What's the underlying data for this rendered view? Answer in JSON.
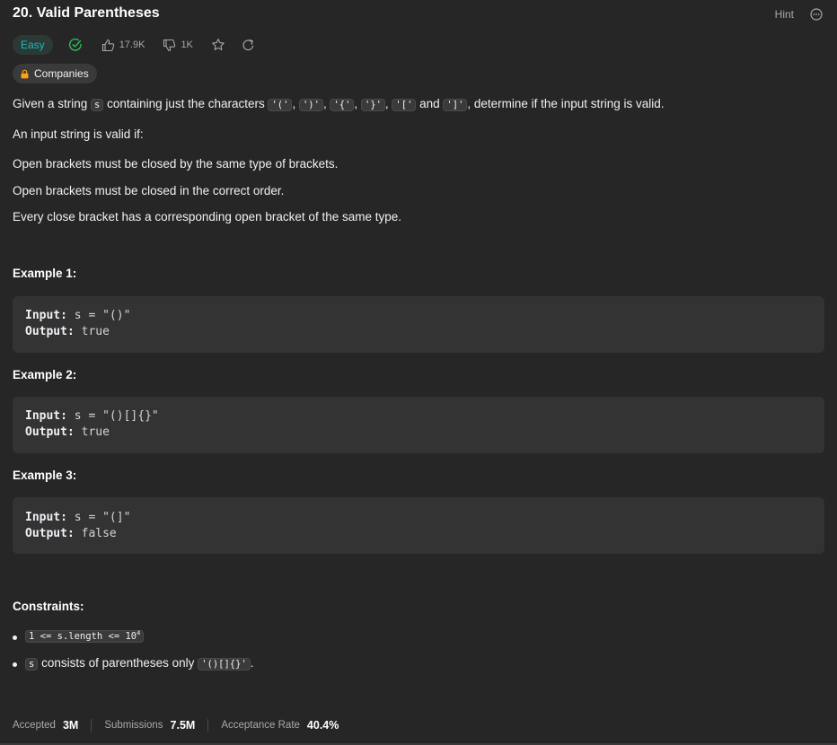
{
  "header": {
    "title": "20. Valid Parentheses",
    "hint_label": "Hint",
    "more_icon": "ellipsis-circle-icon"
  },
  "meta": {
    "difficulty": "Easy",
    "difficulty_color": "#1cbaba",
    "solved_icon": "check-circle-icon",
    "likes": "17.9K",
    "dislikes": "1K",
    "star_icon": "star-icon",
    "share_icon": "share-icon",
    "companies_label": "Companies"
  },
  "description": {
    "p1_prefix": "Given a string ",
    "p1_var": "s",
    "p1_mid": " containing just the characters ",
    "chars": [
      "'('",
      "')'",
      "'{'",
      "'}'",
      "'['",
      "']'"
    ],
    "p1_sep": ", ",
    "p1_and": " and ",
    "p1_suffix": ", determine if the input string is valid.",
    "p2": "An input string is valid if:",
    "rules": [
      "Open brackets must be closed by the same type of brackets.",
      "Open brackets must be closed in the correct order.",
      "Every close bracket has a corresponding open bracket of the same type."
    ]
  },
  "examples": [
    {
      "heading": "Example 1:",
      "input_label": "Input:",
      "input": "s = \"()\"",
      "output_label": "Output:",
      "output": "true"
    },
    {
      "heading": "Example 2:",
      "input_label": "Input:",
      "input": "s = \"()[]{}\"",
      "output_label": "Output:",
      "output": "true"
    },
    {
      "heading": "Example 3:",
      "input_label": "Input:",
      "input": "s = \"(]\"",
      "output_label": "Output:",
      "output": "false"
    }
  ],
  "constraints": {
    "heading": "Constraints:",
    "c1_code": "1 <= s.length <= 10",
    "c1_sup": "4",
    "c2_var": "s",
    "c2_text": " consists of parentheses only ",
    "c2_code": "'()[]{}'",
    "c2_end": "."
  },
  "stats": {
    "accepted_label": "Accepted",
    "accepted_value": "3M",
    "submissions_label": "Submissions",
    "submissions_value": "7.5M",
    "rate_label": "Acceptance Rate",
    "rate_value": "40.4%"
  }
}
